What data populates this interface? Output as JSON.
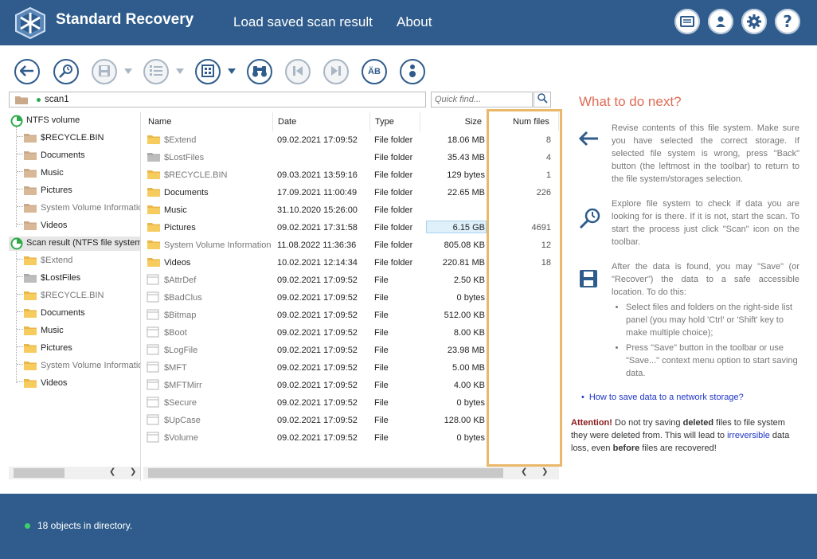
{
  "header": {
    "app_title": "Standard Recovery",
    "menu": [
      "Load saved scan result",
      "About"
    ],
    "icons": [
      "display-icon",
      "user-icon",
      "gear-icon",
      "help-icon"
    ]
  },
  "toolbar": {
    "buttons": [
      "back-icon",
      "explore-icon",
      "save-icon",
      "select-icon",
      "view-icon",
      "find-icon",
      "prev-icon",
      "next-icon",
      "case-icon",
      "info-icon"
    ],
    "case_label": "ÄB"
  },
  "path": {
    "value": "scan1"
  },
  "find": {
    "placeholder": "Quick find..."
  },
  "tree": {
    "items": [
      {
        "label": "NTFS volume",
        "icon": "volume"
      },
      {
        "label": "$RECYCLE.BIN",
        "icon": "folder"
      },
      {
        "label": "Documents",
        "icon": "folder"
      },
      {
        "label": "Music",
        "icon": "folder"
      },
      {
        "label": "Pictures",
        "icon": "folder"
      },
      {
        "label": "System Volume Informatio",
        "icon": "folder"
      },
      {
        "label": "Videos",
        "icon": "folder"
      },
      {
        "label": "Scan result (NTFS file system;",
        "icon": "volume"
      },
      {
        "label": "$Extend",
        "icon": "folder"
      },
      {
        "label": "$LostFiles",
        "icon": "folder-gray"
      },
      {
        "label": "$RECYCLE.BIN",
        "icon": "folder"
      },
      {
        "label": "Documents",
        "icon": "folder"
      },
      {
        "label": "Music",
        "icon": "folder"
      },
      {
        "label": "Pictures",
        "icon": "folder"
      },
      {
        "label": "System Volume Informatio",
        "icon": "folder"
      },
      {
        "label": "Videos",
        "icon": "folder"
      }
    ]
  },
  "list": {
    "columns": [
      "Name",
      "Date",
      "Type",
      "Size",
      "Num files"
    ],
    "rows": [
      {
        "name": "$Extend",
        "date": "09.02.2021 17:09:52",
        "type": "File folder",
        "size": "18.06 MB",
        "num": "8",
        "icon": "folder",
        "dim": true
      },
      {
        "name": "$LostFiles",
        "date": "",
        "type": "File folder",
        "size": "35.43 MB",
        "num": "4",
        "icon": "folder-gray",
        "dim": true
      },
      {
        "name": "$RECYCLE.BIN",
        "date": "09.03.2021 13:59:16",
        "type": "File folder",
        "size": "129 bytes",
        "num": "1",
        "icon": "folder",
        "dim": true
      },
      {
        "name": "Documents",
        "date": "17.09.2021 11:00:49",
        "type": "File folder",
        "size": "22.65 MB",
        "num": "226",
        "icon": "folder",
        "dim": false
      },
      {
        "name": "Music",
        "date": "31.10.2020 15:26:00",
        "type": "File folder",
        "size": "",
        "num": "",
        "icon": "folder",
        "dim": false
      },
      {
        "name": "Pictures",
        "date": "09.02.2021 17:31:58",
        "type": "File folder",
        "size": "6.15 GB",
        "num": "4691",
        "icon": "folder",
        "dim": false
      },
      {
        "name": "System Volume Information",
        "date": "11.08.2022 11:36:36",
        "type": "File folder",
        "size": "805.08 KB",
        "num": "12",
        "icon": "folder",
        "dim": true
      },
      {
        "name": "Videos",
        "date": "10.02.2021 12:14:34",
        "type": "File folder",
        "size": "220.81 MB",
        "num": "18",
        "icon": "folder",
        "dim": false
      },
      {
        "name": "$AttrDef",
        "date": "09.02.2021 17:09:52",
        "type": "File",
        "size": "2.50 KB",
        "num": "",
        "icon": "file",
        "dim": true
      },
      {
        "name": "$BadClus",
        "date": "09.02.2021 17:09:52",
        "type": "File",
        "size": "0 bytes",
        "num": "",
        "icon": "file",
        "dim": true
      },
      {
        "name": "$Bitmap",
        "date": "09.02.2021 17:09:52",
        "type": "File",
        "size": "512.00 KB",
        "num": "",
        "icon": "file",
        "dim": true
      },
      {
        "name": "$Boot",
        "date": "09.02.2021 17:09:52",
        "type": "File",
        "size": "8.00 KB",
        "num": "",
        "icon": "file",
        "dim": true
      },
      {
        "name": "$LogFile",
        "date": "09.02.2021 17:09:52",
        "type": "File",
        "size": "23.98 MB",
        "num": "",
        "icon": "file",
        "dim": true
      },
      {
        "name": "$MFT",
        "date": "09.02.2021 17:09:52",
        "type": "File",
        "size": "5.00 MB",
        "num": "",
        "icon": "file",
        "dim": true
      },
      {
        "name": "$MFTMirr",
        "date": "09.02.2021 17:09:52",
        "type": "File",
        "size": "4.00 KB",
        "num": "",
        "icon": "file",
        "dim": true
      },
      {
        "name": "$Secure",
        "date": "09.02.2021 17:09:52",
        "type": "File",
        "size": "0 bytes",
        "num": "",
        "icon": "file",
        "dim": true
      },
      {
        "name": "$UpCase",
        "date": "09.02.2021 17:09:52",
        "type": "File",
        "size": "128.00 KB",
        "num": "",
        "icon": "file",
        "dim": true
      },
      {
        "name": "$Volume",
        "date": "09.02.2021 17:09:52",
        "type": "File",
        "size": "0 bytes",
        "num": "",
        "icon": "file",
        "dim": true
      }
    ],
    "selected_size_row": 5
  },
  "help": {
    "title": "What to do next?",
    "p1": "Revise contents of this file system. Make sure you have selected the correct storage. If selected file system is wrong, press \"Back\" button (the leftmost in the toolbar) to return to the file system/storages selection.",
    "p2": "Explore file system to check if data you are looking for is there. If it is not, start the scan. To start the process just click \"Scan\" icon on the toolbar.",
    "p3": "After the data is found, you may \"Save\" (or \"Recover\") the data to a safe accessible location. To do this:",
    "bullets": [
      "Select files and folders on the right-side list panel (you may hold 'Ctrl' or 'Shift' key to make multiple choice);",
      "Press \"Save\" button in the toolbar or use \"Save...\" context menu option to start saving data."
    ],
    "link": "How to save data to a network storage?",
    "attn": {
      "a": "Attention!",
      "b": " Do not try saving ",
      "c": "deleted",
      "d": " files to file system they were deleted from. This will lead to ",
      "e": "irreversible",
      "f": " data loss, even ",
      "g": "before",
      "h": " files are recovered!"
    }
  },
  "status": {
    "text": "18 objects in directory."
  },
  "colors": {
    "header": "#2f5c8c",
    "accent": "#e06b55",
    "highlight": "#eab86a",
    "link": "#1f35c4"
  }
}
